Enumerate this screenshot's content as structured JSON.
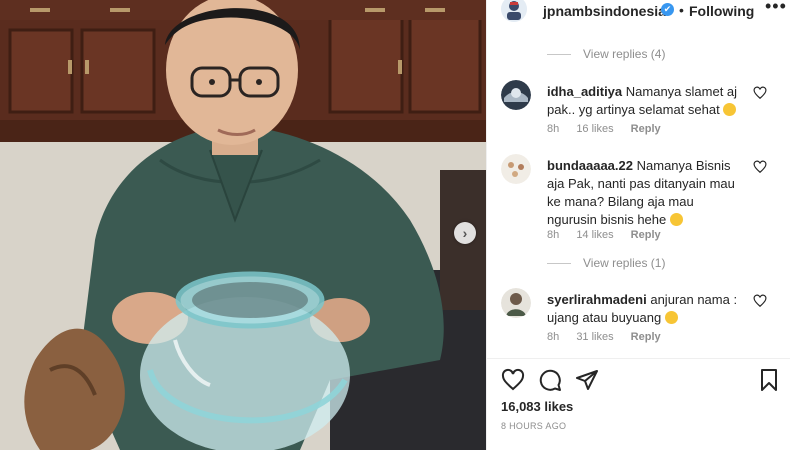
{
  "post": {
    "username": "jpnambsindonesia",
    "verified_icon": "check-icon",
    "separator": "•",
    "follow_status": "Following",
    "more_icon": "•••",
    "likes": "16,083 likes",
    "time": "8 HOURS AGO"
  },
  "view_replies": [
    {
      "label": "View replies (4)"
    },
    {
      "label": "View replies (1)"
    }
  ],
  "comments": [
    {
      "username": "idha_aditiya",
      "text": "Namanya slamet aj pak.. yg artinya selamat sehat",
      "age": "8h",
      "likes": "16 likes",
      "reply": "Reply"
    },
    {
      "username": "bundaaaaa.22",
      "text": "Namanya Bisnis aja Pak, nanti pas ditanyain mau ke mana? Bilang aja mau ngurusin bisnis hehe",
      "age": "8h",
      "likes": "14 likes",
      "reply": "Reply"
    },
    {
      "username": "syerlirahmadeni",
      "text": "anjuran nama : ujang atau buyuang",
      "age": "8h",
      "likes": "31 likes",
      "reply": "Reply"
    }
  ],
  "carousel": {
    "next_icon": "›"
  },
  "colors": {
    "verified": "#3897f0",
    "text": "#262626",
    "muted": "#8e8e8e"
  }
}
